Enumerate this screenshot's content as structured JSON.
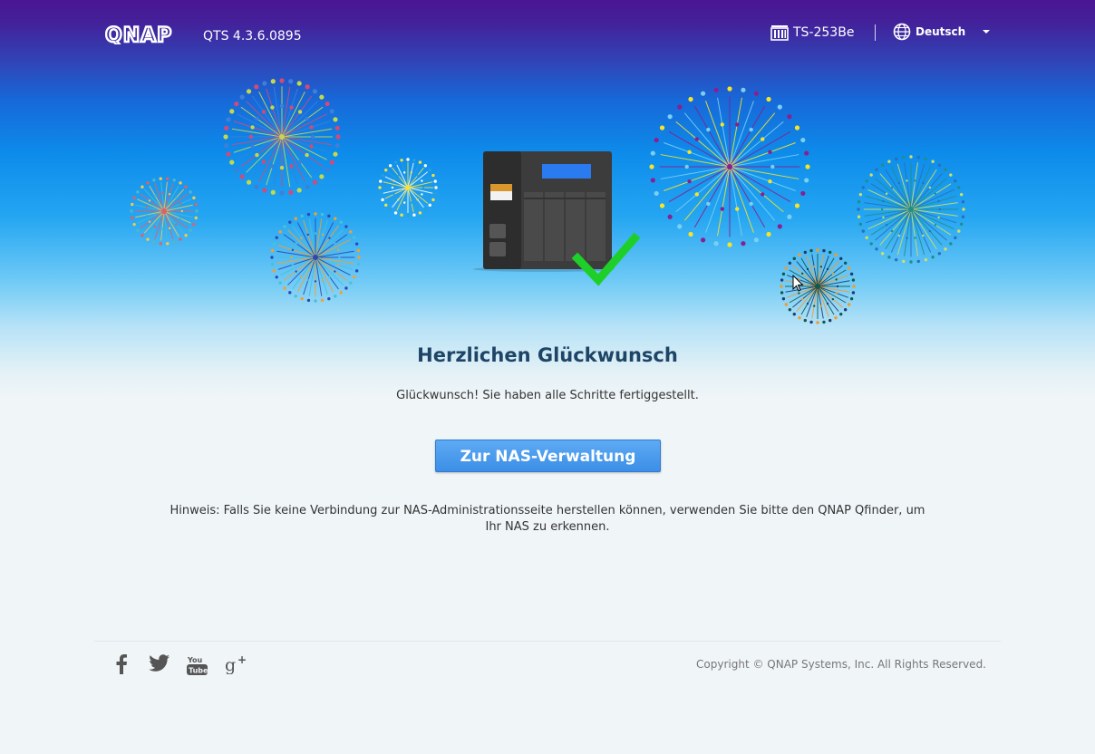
{
  "header": {
    "logo_text": "QNAP",
    "version": "QTS 4.3.6.0895",
    "model": "TS-253Be",
    "language": "Deutsch",
    "icons": {
      "model": "nas-server-icon",
      "language": "globe-icon",
      "dropdown": "caret-down-icon"
    }
  },
  "hero": {
    "illustration": "nas-device-with-checkmark",
    "decoration": "fireworks",
    "colors": {
      "check": "#1fcf29",
      "device": "#3c3c3c",
      "screen": "#2b7bf0"
    }
  },
  "main": {
    "title": "Herzlichen Glückwunsch",
    "subtitle": "Glückwunsch! Sie haben alle Schritte fertiggestellt.",
    "button_label": "Zur NAS-Verwaltung",
    "note": "Hinweis: Falls Sie keine Verbindung zur NAS-Administrationsseite herstellen können, verwenden Sie bitte den QNAP Qfinder, um Ihr NAS zu erkennen."
  },
  "footer": {
    "social": [
      "facebook-icon",
      "twitter-icon",
      "youtube-icon",
      "google-plus-icon"
    ],
    "copyright": "Copyright © QNAP Systems, Inc. All Rights Reserved."
  },
  "theme": {
    "accent": "#3b8fe6",
    "title_color": "#1e4566",
    "header_top": "#4a1593"
  }
}
